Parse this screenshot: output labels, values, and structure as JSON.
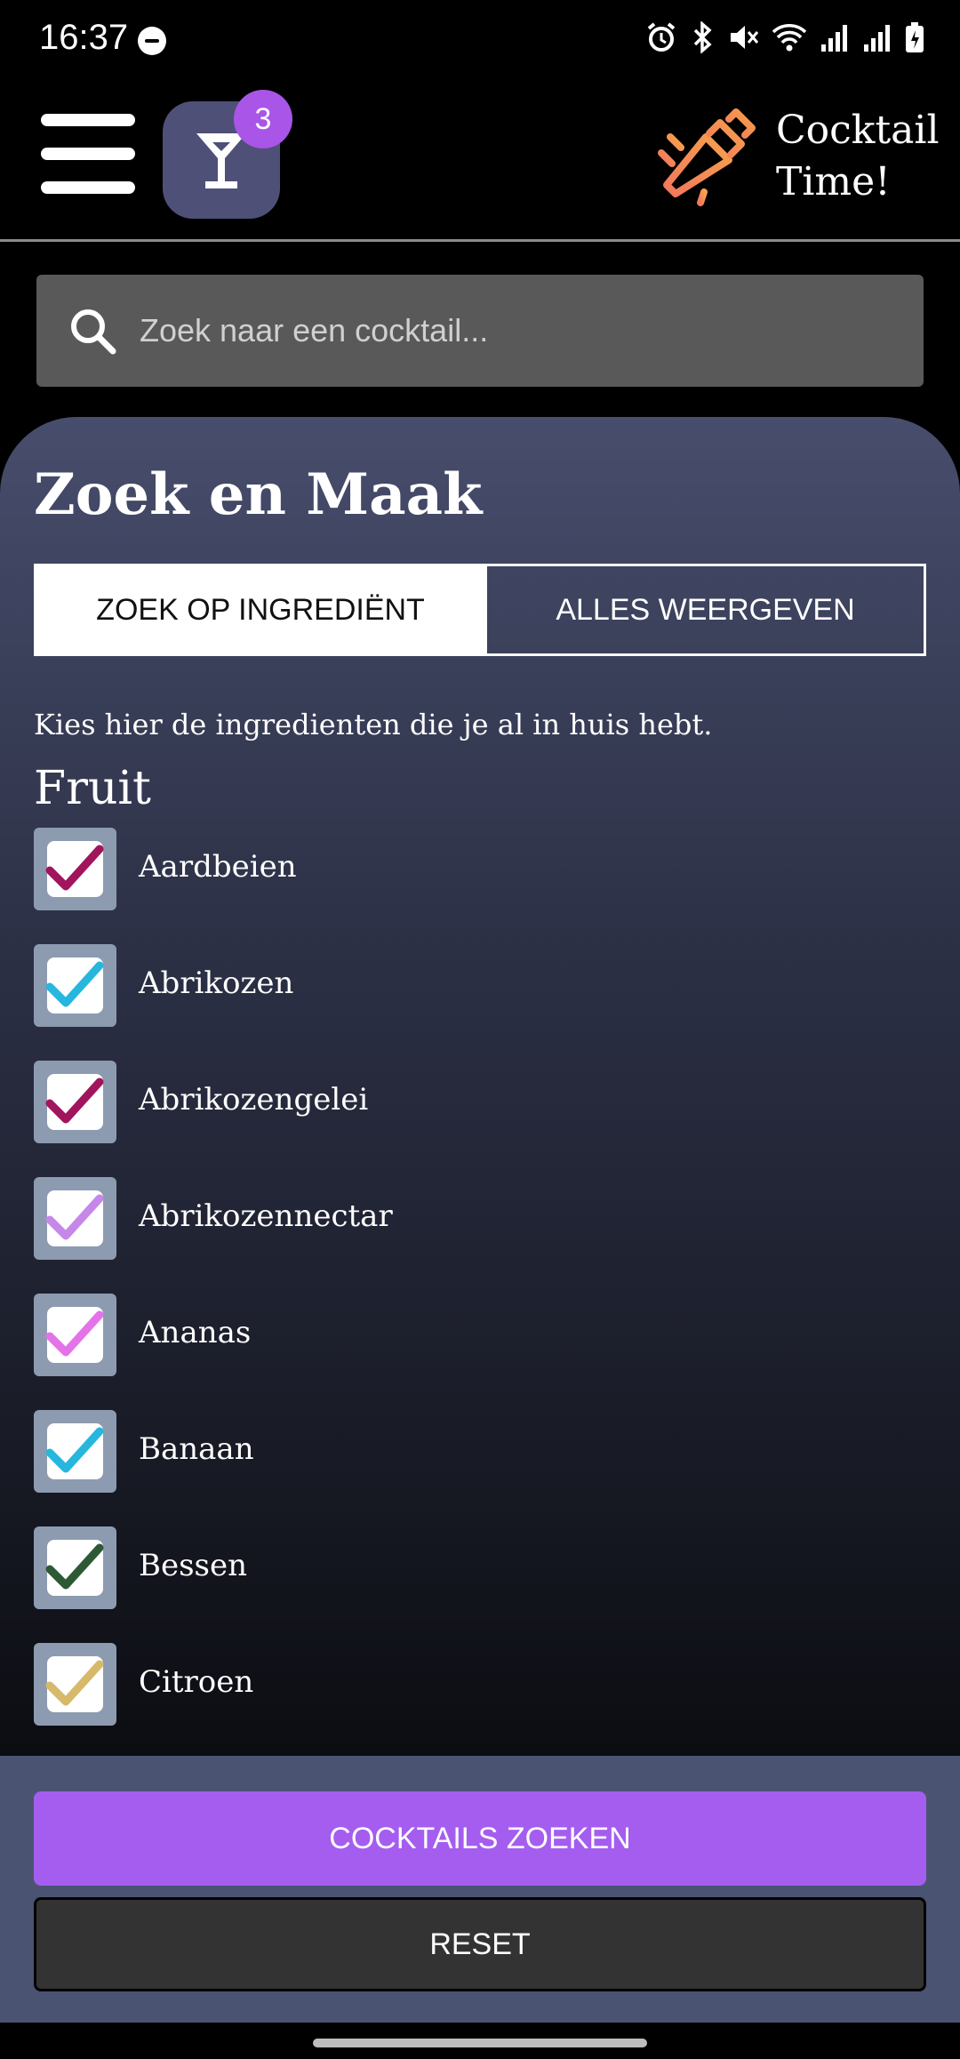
{
  "status": {
    "time": "16:37",
    "icons": [
      "do-not-disturb-icon",
      "alarm-icon",
      "bluetooth-icon",
      "mute-icon",
      "wifi-icon",
      "signal-icon",
      "signal-icon",
      "battery-icon"
    ]
  },
  "appbar": {
    "cart_count": "3",
    "brand_line1": "Cocktail",
    "brand_line2": "Time!",
    "accent": "#a855e8",
    "logo_color": "#f0875a"
  },
  "search": {
    "placeholder": "Zoek naar een cocktail..."
  },
  "panel": {
    "title": "Zoek en Maak",
    "tabs": [
      {
        "label": "ZOEK OP INGREDIËNT",
        "active": true
      },
      {
        "label": "ALLES WEERGEVEN",
        "active": false
      }
    ],
    "hint": "Kies hier de ingredienten die je al in huis hebt.",
    "section_title": "Fruit",
    "ingredients": [
      {
        "label": "Aardbeien",
        "checked": true,
        "check_color": "#a0155c"
      },
      {
        "label": "Abrikozen",
        "checked": true,
        "check_color": "#27b6dd"
      },
      {
        "label": "Abrikozengelei",
        "checked": true,
        "check_color": "#a0155c"
      },
      {
        "label": "Abrikozennectar",
        "checked": true,
        "check_color": "#c787e8"
      },
      {
        "label": "Ananas",
        "checked": true,
        "check_color": "#e472e8"
      },
      {
        "label": "Banaan",
        "checked": true,
        "check_color": "#27b6dd"
      },
      {
        "label": "Bessen",
        "checked": true,
        "check_color": "#2d5a35"
      },
      {
        "label": "Citroen",
        "checked": true,
        "check_color": "#d6b96a"
      }
    ]
  },
  "actions": {
    "search_label": "COCKTAILS ZOEKEN",
    "reset_label": "RESET"
  }
}
